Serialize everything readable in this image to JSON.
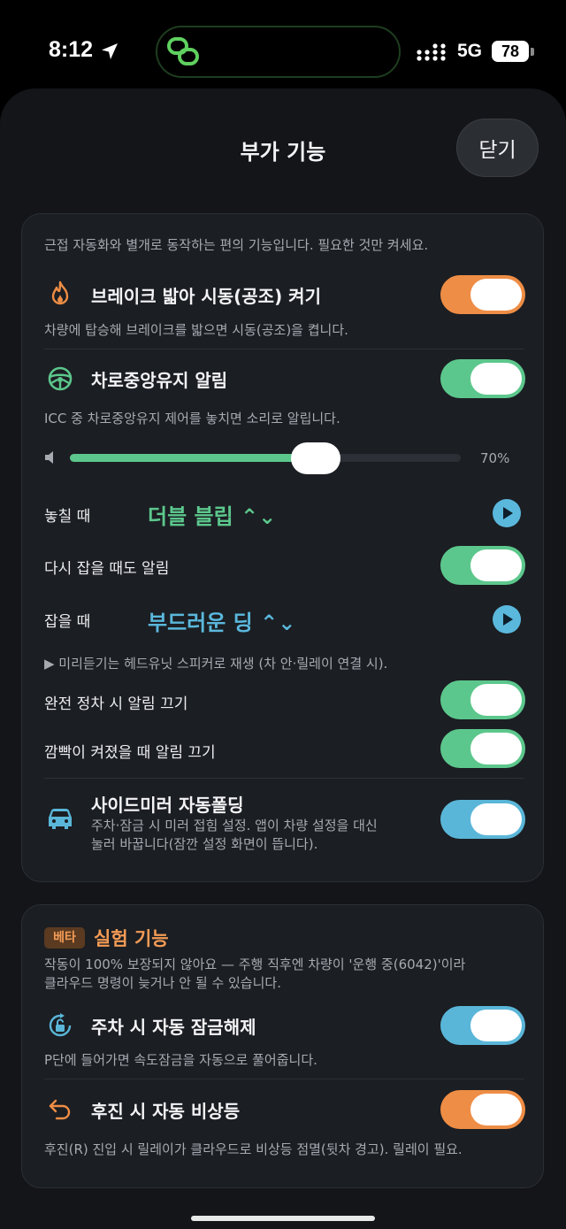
{
  "status": {
    "time": "8:12",
    "network": "5G",
    "battery": "78"
  },
  "header": {
    "title": "부가 기능",
    "close_label": "닫기"
  },
  "card1": {
    "intro": "근접 자동화와 별개로 동작하는 편의 기능입니다. 필요한 것만 켜세요.",
    "brake": {
      "title": "브레이크 밟아 시동(공조) 켜기",
      "desc": "차량에 탑승해 브레이크를 밟으면 시동(공조)을 켭니다.",
      "on": true,
      "color": "#ee8d45"
    },
    "lane": {
      "title": "차로중앙유지 알림",
      "desc": "ICC 중 차로중앙유지 제어를 놓치면 소리로 알립니다.",
      "on": true,
      "volume": 0.7,
      "volume_label": "70%",
      "miss_label": "놓칠 때",
      "miss_sound": "더블 블립 ⌃⌄",
      "regain_alert_label": "다시 잡을 때도 알림",
      "regain_alert_on": true,
      "regain_label": "잡을 때",
      "regain_sound": "부드러운 딩 ⌃⌄",
      "preview_note": "▶ 미리듣기는 헤드유닛 스피커로 재생 (차 안·릴레이 연결 시).",
      "full_stop_label": "완전 정차 시 알림 끄기",
      "full_stop_on": true,
      "blinker_label": "깜빡이 켜졌을 때 알림 끄기",
      "blinker_on": true
    },
    "mirror": {
      "title": "사이드미러 자동폴딩",
      "desc_line1": "주차·잠금 시 미러 접힘 설정. 앱이 차량 설정을 대신",
      "desc_line2": "눌러 바꿉니다(잠깐 설정 화면이 뜹니다).",
      "on": true
    }
  },
  "card2": {
    "badge": "베타",
    "title": "실험 기능",
    "warning_line1": "작동이 100% 보장되지 않아요 — 주행 직후엔 차량이 '운행 중(6042)'이라",
    "warning_line2": "클라우드 명령이 늦거나 안 될 수 있습니다.",
    "unlock": {
      "title": "주차 시 자동 잠금해제",
      "desc": "P단에 들어가면 속도잠금을 자동으로 풀어줍니다.",
      "on": true
    },
    "hazard": {
      "title": "후진 시 자동 비상등",
      "desc": "후진(R) 진입 시 릴레이가 클라우드로 비상등 점멸(뒷차 경고). 릴레이 필요.",
      "on": true
    }
  },
  "colors": {
    "orange": "#ee8d45",
    "green": "#5cc78c",
    "blue": "#5ab6d8",
    "card": "#1b1e23"
  },
  "icons": [
    "location-arrow-icon",
    "link-icon",
    "signal-icon",
    "flame-icon",
    "steering-wheel-icon",
    "speaker-icon",
    "play-icon",
    "car-icon",
    "lock-rotate-icon",
    "undo-arrow-icon"
  ]
}
